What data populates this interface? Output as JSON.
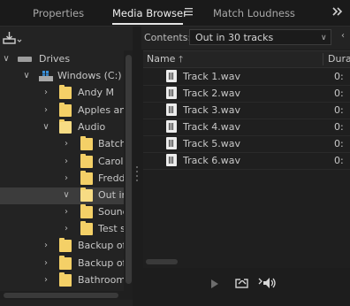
{
  "tabs": [
    {
      "label": "Properties"
    },
    {
      "label": "Media Browser"
    },
    {
      "label": "Match Loudness"
    }
  ],
  "tab_menu_icon": "hamburger-icon",
  "overflow_icon": "double-chevron-right-icon",
  "contents": {
    "label": "Contents:",
    "value": "Out in 30 tracks"
  },
  "tree": [
    {
      "label": "Drives"
    },
    {
      "label": "Windows (C:)"
    },
    {
      "label": "Andy M"
    },
    {
      "label": "Apples and"
    },
    {
      "label": "Audio"
    },
    {
      "label": "Batch"
    },
    {
      "label": "Caroli"
    },
    {
      "label": "Fredd"
    },
    {
      "label": "Out in"
    },
    {
      "label": "Sound"
    },
    {
      "label": "Test s"
    },
    {
      "label": "Backup of"
    },
    {
      "label": "Backup of"
    },
    {
      "label": "Bathroom"
    }
  ],
  "columns": {
    "name": "Name",
    "duration": "Dura"
  },
  "files": [
    {
      "name": "Track 1.wav",
      "duration": "0:"
    },
    {
      "name": "Track 2.wav",
      "duration": "0:"
    },
    {
      "name": "Track 3.wav",
      "duration": "0:"
    },
    {
      "name": "Track 4.wav",
      "duration": "0:"
    },
    {
      "name": "Track 5.wav",
      "duration": "0:"
    },
    {
      "name": "Track 6.wav",
      "duration": "0:"
    }
  ],
  "colors": {
    "accent_folder": "#f4d067",
    "selected_row": "#3c3c3c"
  }
}
